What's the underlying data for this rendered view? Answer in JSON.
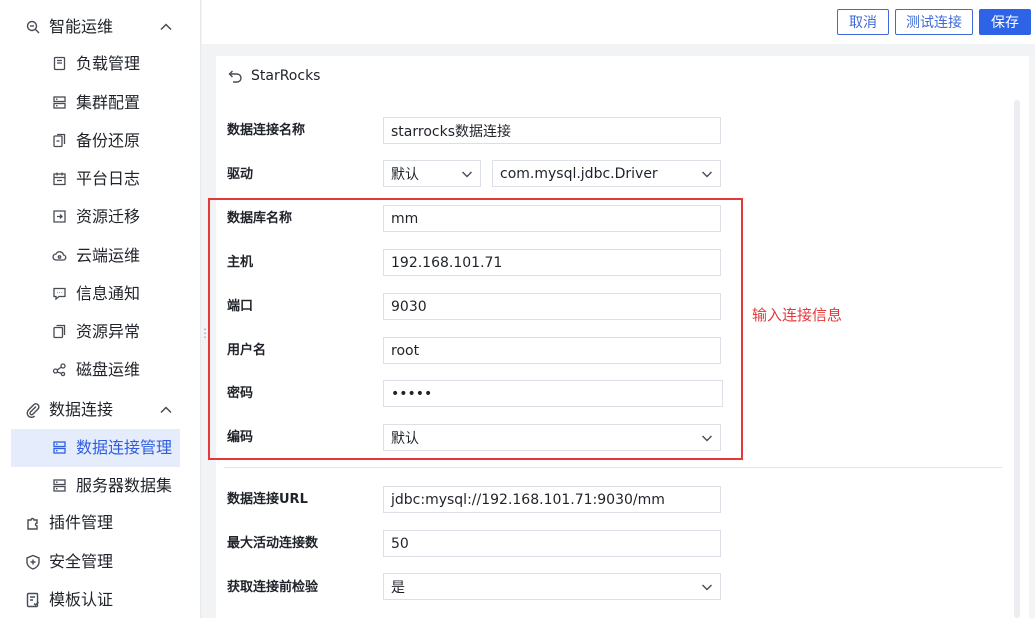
{
  "sidebar": {
    "groups": [
      {
        "label": "智能运维",
        "icon": "ops-icon"
      },
      {
        "label": "数据连接",
        "icon": "paperclip-icon"
      },
      {
        "label": "插件管理",
        "icon": "plugin-icon"
      },
      {
        "label": "安全管理",
        "icon": "shield-icon"
      },
      {
        "label": "模板认证",
        "icon": "template-icon"
      }
    ],
    "ops_items": [
      {
        "label": "负载管理",
        "icon": "load-icon"
      },
      {
        "label": "集群配置",
        "icon": "cluster-icon"
      },
      {
        "label": "备份还原",
        "icon": "backup-icon"
      },
      {
        "label": "平台日志",
        "icon": "calendar-icon"
      },
      {
        "label": "资源迁移",
        "icon": "migrate-icon"
      },
      {
        "label": "云端运维",
        "icon": "cloud-icon"
      },
      {
        "label": "信息通知",
        "icon": "message-icon"
      },
      {
        "label": "资源异常",
        "icon": "copy-icon"
      },
      {
        "label": "磁盘运维",
        "icon": "share-icon"
      }
    ],
    "data_items": [
      {
        "label": "数据连接管理",
        "icon": "database-icon",
        "active": true
      },
      {
        "label": "服务器数据集",
        "icon": "server-icon"
      }
    ]
  },
  "toolbar": {
    "cancel_label": "取消",
    "test_label": "测试连接",
    "save_label": "保存"
  },
  "form": {
    "title": "StarRocks",
    "fields": {
      "conn_name": {
        "label": "数据连接名称",
        "value": "starrocks数据连接"
      },
      "driver": {
        "label": "驱动",
        "mode": "默认",
        "value": "com.mysql.jdbc.Driver"
      },
      "db_name": {
        "label": "数据库名称",
        "value": "mm"
      },
      "host": {
        "label": "主机",
        "value": "192.168.101.71"
      },
      "port": {
        "label": "端口",
        "value": "9030"
      },
      "username": {
        "label": "用户名",
        "value": "root"
      },
      "password": {
        "label": "密码",
        "value": "•••••"
      },
      "encoding": {
        "label": "编码",
        "value": "默认"
      },
      "url": {
        "label": "数据连接URL",
        "value": "jdbc:mysql://192.168.101.71:9030/mm"
      },
      "max_active": {
        "label": "最大活动连接数",
        "value": "50"
      },
      "validate": {
        "label": "获取连接前检验",
        "value": "是"
      }
    }
  },
  "annotation": "输入连接信息",
  "colors": {
    "accent": "#2f63e6",
    "highlight": "#e5383b",
    "active_bg": "#e5ecfc"
  }
}
